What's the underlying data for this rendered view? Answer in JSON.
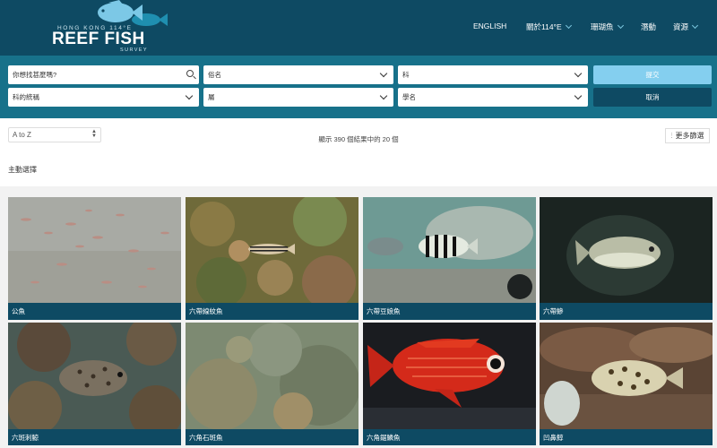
{
  "header": {
    "logo": {
      "top_text": "HONG KONG 114°E",
      "main_text": "REEF FISH",
      "sub_text": "SURVEY"
    },
    "nav": [
      {
        "label": "ENGLISH",
        "has_dropdown": false
      },
      {
        "label": "關於114°E",
        "has_dropdown": true
      },
      {
        "label": "珊瑚魚",
        "has_dropdown": true
      },
      {
        "label": "潛動",
        "has_dropdown": false
      },
      {
        "label": "資源",
        "has_dropdown": true
      }
    ]
  },
  "filters": {
    "search_placeholder": "你想找甚麼嗎?",
    "common_name": "俗名",
    "family": "科",
    "order_family": "科的統稱",
    "group": "屬",
    "scientific_name": "學名",
    "submit_label": "提交",
    "cancel_label": "取消"
  },
  "results": {
    "sort_value": "A to Z",
    "summary": "顯示 390 個結果中的 20 個",
    "more_filters_label": "更多篩選",
    "featured_heading": "主動選擇"
  },
  "fish": [
    {
      "name": "公魚",
      "icon": "fish-school-photo"
    },
    {
      "name": "六帶線紋魚",
      "icon": "striped-fish-photo"
    },
    {
      "name": "六帶豆娘魚",
      "icon": "damselfish-photo"
    },
    {
      "name": "六帶鰺",
      "icon": "jack-fish-photo"
    },
    {
      "name": "六斑刺鯨",
      "icon": "porcupinefish-photo"
    },
    {
      "name": "六角石斑魚",
      "icon": "grouper-photo"
    },
    {
      "name": "六角鋸鱗魚",
      "icon": "squirrelfish-photo"
    },
    {
      "name": "凹鼻鯙",
      "icon": "pufferfish-photo"
    }
  ],
  "colors": {
    "header_bg": "#0e4a63",
    "filter_bg": "#17718a",
    "submit_btn": "#84cfef",
    "label_bg": "#0e4a63"
  }
}
